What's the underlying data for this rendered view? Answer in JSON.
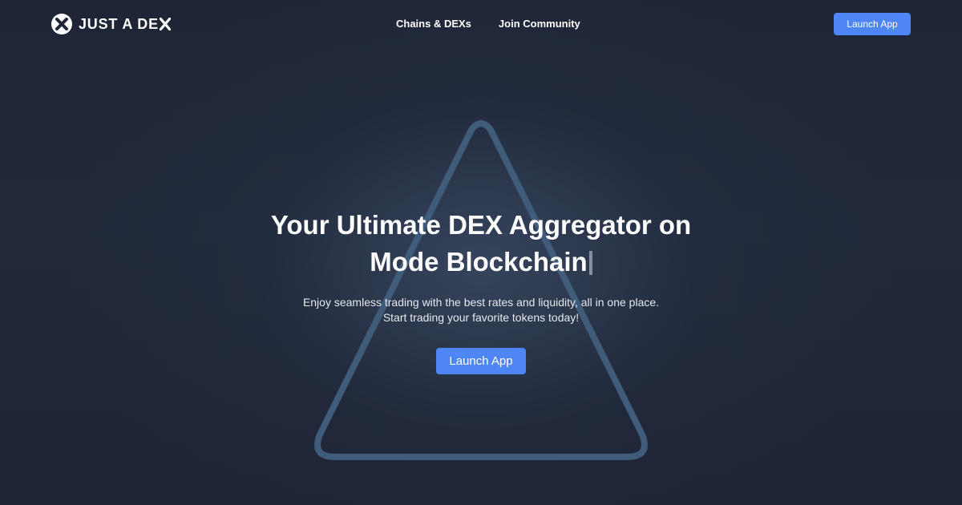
{
  "brand": {
    "name": "JUST A DE",
    "logo_icon": "x-logo-icon"
  },
  "nav": {
    "items": [
      {
        "label": "Chains & DEXs"
      },
      {
        "label": "Join Community"
      }
    ]
  },
  "header": {
    "launch_label": "Launch App"
  },
  "hero": {
    "title_line1": "Your Ultimate DEX Aggregator on",
    "title_line2": "Mode Blockchain",
    "subtitle_line1": "Enjoy seamless trading with the best rates and liquidity, all in one place.",
    "subtitle_line2": "Start trading your favorite tokens today!",
    "cta_label": "Launch App"
  },
  "colors": {
    "background": "#1f2637",
    "accent": "#4f86f7",
    "triangle_stroke": "#40607f"
  }
}
